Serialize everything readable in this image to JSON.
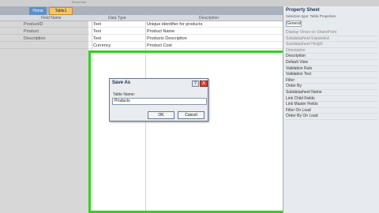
{
  "app": {
    "window_title": "ShareHelp"
  },
  "tabs": [
    {
      "label": "Home"
    },
    {
      "label": "Table1"
    }
  ],
  "grid": {
    "headers": {
      "field_name": "Field Name",
      "data_type": "Data Type",
      "description": "Description"
    },
    "rows": [
      {
        "field_name": "ProductID",
        "data_type": "Text",
        "description": "Unique identifier for products"
      },
      {
        "field_name": "Product",
        "data_type": "Text",
        "description": "Product Name"
      },
      {
        "field_name": "Description",
        "data_type": "Text",
        "description": "Products Description"
      },
      {
        "field_name": "",
        "data_type": "Currency",
        "description": "Product Cost"
      }
    ]
  },
  "property_sheet": {
    "title": "Property Sheet",
    "selection": "Selection type: Table Properties",
    "tab": "General",
    "items": [
      "Display Views on SharePoint",
      "Subdatasheet Expanded",
      "Subdatasheet Height",
      "Orientation",
      "Description",
      "Default View",
      "Validation Rule",
      "Validation Text",
      "Filter",
      "Order By",
      "Subdatasheet Name",
      "Link Child Fields",
      "Link Master Fields",
      "Filter On Load",
      "Order By On Load"
    ]
  },
  "dialog": {
    "title": "Save As",
    "help": "?",
    "close": "X",
    "label": "Table Name:",
    "value": "Products",
    "ok": "OK",
    "cancel": "Cancel"
  },
  "colors": {
    "highlight": "#33d11f",
    "active_tab": "#f3c469"
  }
}
